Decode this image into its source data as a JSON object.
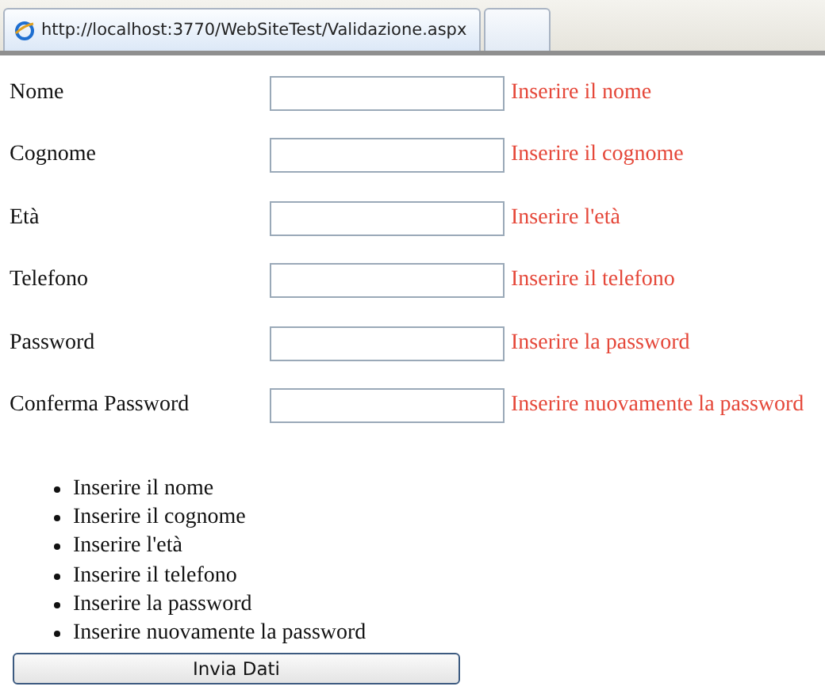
{
  "browser": {
    "tabs": [
      {
        "title": "http://localhost:3770/WebSiteTest/Validazione.aspx",
        "selected": true
      },
      {
        "selected": false
      }
    ]
  },
  "form": {
    "fields": [
      {
        "label": "Nome",
        "error": "Inserire il nome"
      },
      {
        "label": "Cognome",
        "error": "Inserire il cognome"
      },
      {
        "label": "Età",
        "error": "Inserire l'età"
      },
      {
        "label": "Telefono",
        "error": "Inserire il telefono"
      },
      {
        "label": "Password",
        "error": "Inserire la password"
      },
      {
        "label": "Conferma Password",
        "error": "Inserire nuovamente la password"
      }
    ],
    "summary": [
      "Inserire il nome",
      "Inserire il cognome",
      "Inserire l'età",
      "Inserire il telefono",
      "Inserire la password",
      "Inserire nuovamente la password"
    ],
    "submit": "Invia Dati"
  }
}
